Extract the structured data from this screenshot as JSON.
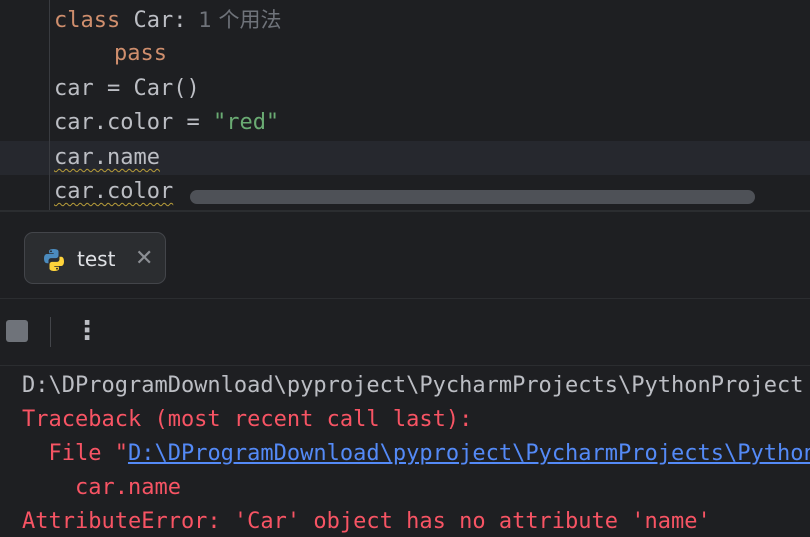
{
  "editor": {
    "line1_keyword": "class",
    "line1_rest": " Car:",
    "line1_hint": "1 个用法",
    "line2_keyword": "pass",
    "line3": "car = Car()",
    "line4_prefix": "car.color = ",
    "line4_string": "\"red\"",
    "line5": "car.name",
    "line6": "car.color"
  },
  "run_tab": {
    "label": "test",
    "close_glyph": "✕"
  },
  "toolbar": {
    "more_glyph": "⋮"
  },
  "console": {
    "command_line": "D:\\DProgramDownload\\pyproject\\PycharmProjects\\PythonProject",
    "traceback_header": "Traceback (most recent call last):",
    "file_prefix": "  File \"",
    "file_link": "D:\\DProgramDownload\\pyproject\\PycharmProjects\\PythonProject\\test.py",
    "code_line": "    car.name",
    "error_line": "AttributeError: 'Car' object has no attribute 'name'"
  },
  "colors": {
    "background": "#1e1f22",
    "keyword": "#cf8e6d",
    "string": "#6aab73",
    "error": "#f75464",
    "link": "#548af7"
  }
}
